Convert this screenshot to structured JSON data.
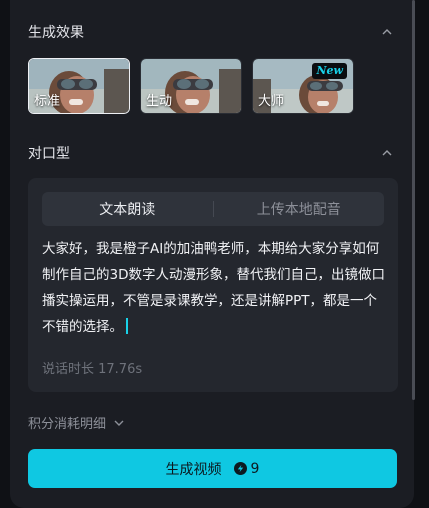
{
  "effect": {
    "title": "生成效果",
    "options": [
      {
        "label": "标准",
        "selected": true,
        "badge": ""
      },
      {
        "label": "生动",
        "selected": false,
        "badge": ""
      },
      {
        "label": "大师",
        "selected": false,
        "badge": "New"
      }
    ]
  },
  "lipsync": {
    "title": "对口型",
    "tabs": [
      {
        "label": "文本朗读",
        "active": true
      },
      {
        "label": "上传本地配音",
        "active": false
      }
    ],
    "script": "大家好，我是橙子AI的加油鸭老师，本期给大家分享如何制作自己的3D数字人动漫形象，替代我们自己，出镜做口播实操运用，不管是录课教学，还是讲解PPT，都是一个不错的选择。",
    "duration": "说话时长 17.76s"
  },
  "points_detail": {
    "label": "积分消耗明细"
  },
  "generate": {
    "label": "生成视频",
    "cost": "9"
  },
  "colors": {
    "accent": "#0fc8e2",
    "panel": "#1b1d23",
    "card": "#24272e"
  },
  "icons": [
    "chevron-up-icon",
    "chevron-down-icon",
    "coin-icon"
  ]
}
